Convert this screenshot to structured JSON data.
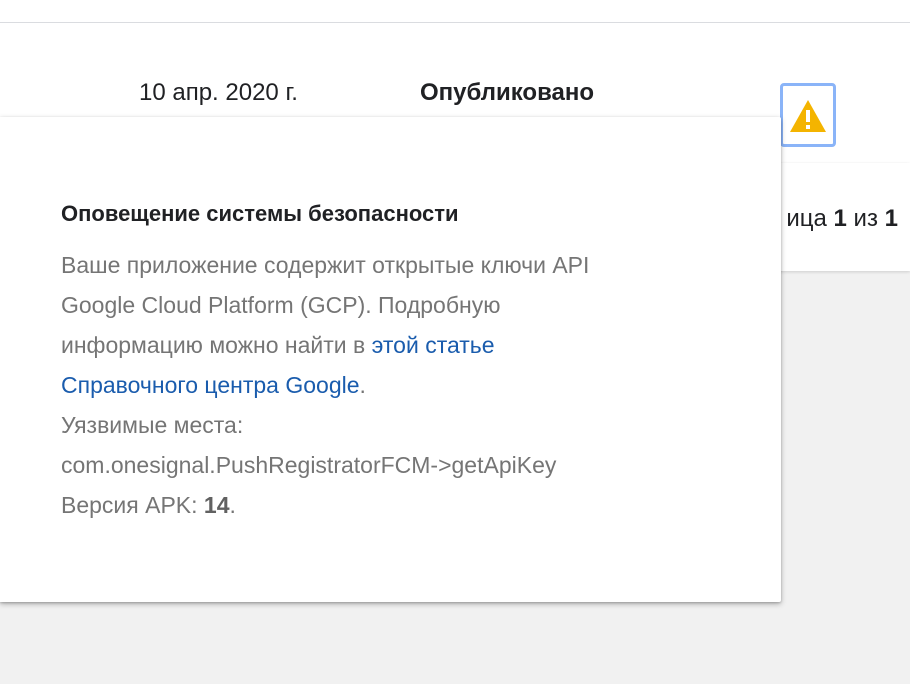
{
  "row": {
    "date": "10 апр. 2020 г.",
    "status": "Опубликовано"
  },
  "alert_button": {
    "icon": "warning-triangle-icon",
    "color": "#f4b400"
  },
  "pager": {
    "prefix": "ица",
    "current": "1",
    "of": "из",
    "total": "1"
  },
  "popup": {
    "title": "Оповещение системы безопасности",
    "line1": "Ваше приложение содержит открытые ключи API",
    "line2": "Google Cloud Platform (GCP). Подробную",
    "line3_text": "информацию можно найти в ",
    "link_part1": "этой статье",
    "link_part2": "Справочного центра Google",
    "link_suffix": ".",
    "vuln_label": "Уязвимые места:",
    "vuln_value": "com.onesignal.PushRegistratorFCM->getApiKey",
    "apk_label": "Версия APK: ",
    "apk_value": "14",
    "apk_suffix": "."
  }
}
